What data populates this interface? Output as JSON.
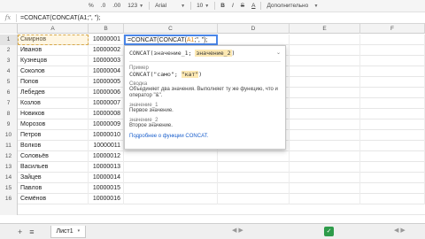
{
  "toolbar": {
    "percent": "%",
    "decimals_dec": ".0",
    "decimals_inc": ".00",
    "number_format": "123",
    "font": "Arial",
    "font_size": "10",
    "bold": "B",
    "italic": "I",
    "strike": "S",
    "text_color": "A",
    "more": "Дополнительно"
  },
  "formula_bar": {
    "fx": "fx",
    "content": "=CONCAT(CONCAT(A1;\", \");"
  },
  "columns": [
    "A",
    "B",
    "C",
    "D",
    "E",
    "F"
  ],
  "active_cell": {
    "prefix": "=CONCAT(CONCAT(",
    "ref": "A1",
    "suffix": ";\", \");"
  },
  "rows": [
    {
      "n": "1",
      "name": "Смирнов",
      "num": "10000001"
    },
    {
      "n": "2",
      "name": "Иванов",
      "num": "10000002"
    },
    {
      "n": "3",
      "name": "Кузнецов",
      "num": "10000003"
    },
    {
      "n": "4",
      "name": "Соколов",
      "num": "10000004"
    },
    {
      "n": "5",
      "name": "Попов",
      "num": "10000005"
    },
    {
      "n": "6",
      "name": "Лебедев",
      "num": "10000006"
    },
    {
      "n": "7",
      "name": "Козлов",
      "num": "10000007"
    },
    {
      "n": "8",
      "name": "Новиков",
      "num": "10000008"
    },
    {
      "n": "9",
      "name": "Морозов",
      "num": "10000009"
    },
    {
      "n": "10",
      "name": "Петров",
      "num": "10000010"
    },
    {
      "n": "11",
      "name": "Волков",
      "num": "10000011"
    },
    {
      "n": "12",
      "name": "Соловьёв",
      "num": "10000012"
    },
    {
      "n": "13",
      "name": "Васильев",
      "num": "10000013"
    },
    {
      "n": "14",
      "name": "Зайцев",
      "num": "10000014"
    },
    {
      "n": "15",
      "name": "Павлов",
      "num": "10000015"
    },
    {
      "n": "16",
      "name": "Семёнов",
      "num": "10000016"
    }
  ],
  "popup": {
    "signature_prefix": "CONCAT(значение_1; ",
    "signature_active": "значение_2",
    "signature_suffix": ")",
    "close": "⌄",
    "example_label": "Пример",
    "example_prefix": "CONCAT(\"само\"; ",
    "example_active": "\"кат\"",
    "example_suffix": ")",
    "summary_label": "Сводка",
    "summary_text": "Объединяет два значения. Выполняет ту же функцию, что и оператор \"&\".",
    "arg1_label": "значение_1",
    "arg1_text": "Первое значение.",
    "arg2_label": "значение_2",
    "arg2_text": "Второе значение.",
    "link": "Подробнее о функции CONCAT."
  },
  "tabs": {
    "add": "+",
    "list": "≡",
    "sheet": "Лист1",
    "caret": "▾"
  },
  "colors": {
    "accent": "#4a86e8",
    "selection": "#d7a84a",
    "explore": "#2e9b4a"
  }
}
